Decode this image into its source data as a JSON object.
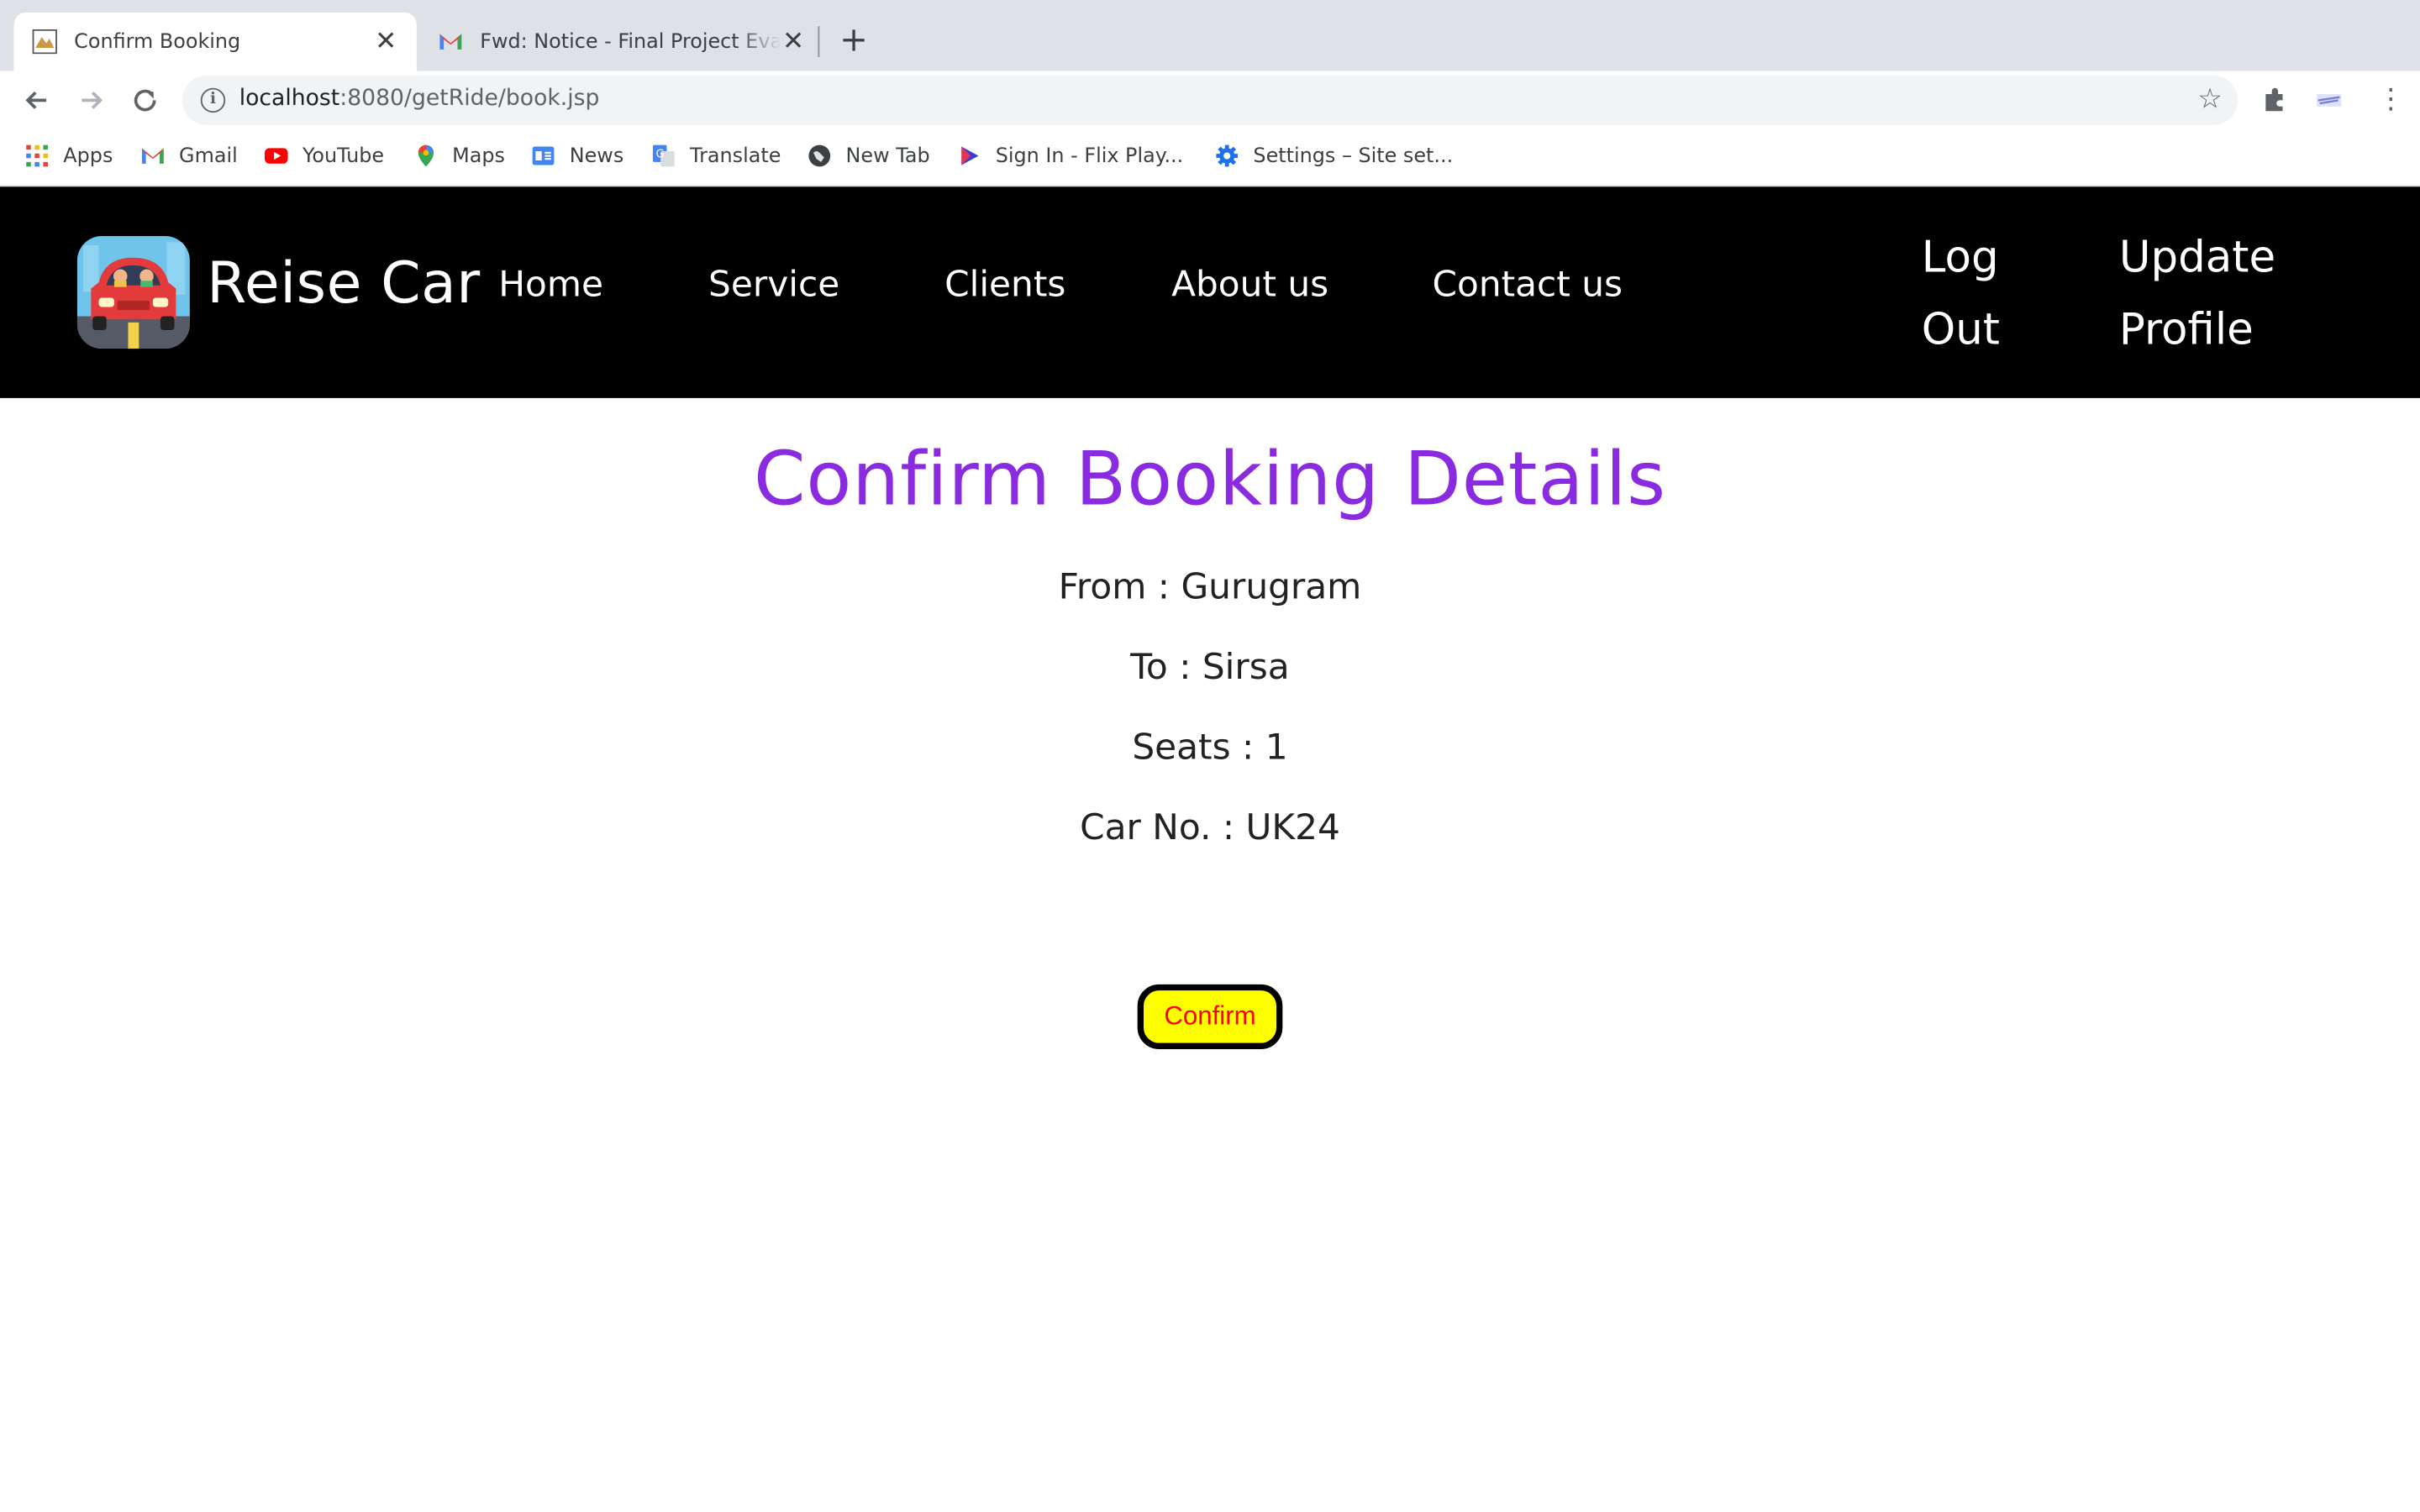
{
  "browser": {
    "tabs": [
      {
        "title": "Confirm Booking",
        "active": true
      },
      {
        "title": "Fwd: Notice - Final Project Evaluation",
        "active": false
      }
    ],
    "url_host": "localhost",
    "url_rest": ":8080/getRide/book.jsp",
    "bookmarks": [
      {
        "label": "Apps",
        "icon": "apps-grid-icon"
      },
      {
        "label": "Gmail",
        "icon": "gmail-icon"
      },
      {
        "label": "YouTube",
        "icon": "youtube-icon"
      },
      {
        "label": "Maps",
        "icon": "maps-pin-icon"
      },
      {
        "label": "News",
        "icon": "news-icon"
      },
      {
        "label": "Translate",
        "icon": "translate-icon"
      },
      {
        "label": "New Tab",
        "icon": "globe-icon"
      },
      {
        "label": "Sign In - Flix Play...",
        "icon": "flix-play-icon"
      },
      {
        "label": "Settings – Site set...",
        "icon": "gear-icon"
      }
    ]
  },
  "site": {
    "brand": "Reise Car",
    "nav": {
      "home": "Home",
      "service": "Service",
      "clients": "Clients",
      "about": "About us",
      "contact": "Contact us",
      "logout_line1": "Log",
      "logout_line2": "Out",
      "update_line1": "Update",
      "update_line2": "Profile"
    }
  },
  "booking": {
    "title": "Confirm Booking Details",
    "from": "From : Gurugram",
    "to": "To : Sirsa",
    "seats": "Seats : 1",
    "car_no": "Car No. : UK24",
    "confirm_label": "Confirm"
  },
  "colors": {
    "title": "#8a2be2",
    "header_bg": "#000000",
    "button_bg": "#ffff00",
    "button_text": "#ff0000"
  }
}
